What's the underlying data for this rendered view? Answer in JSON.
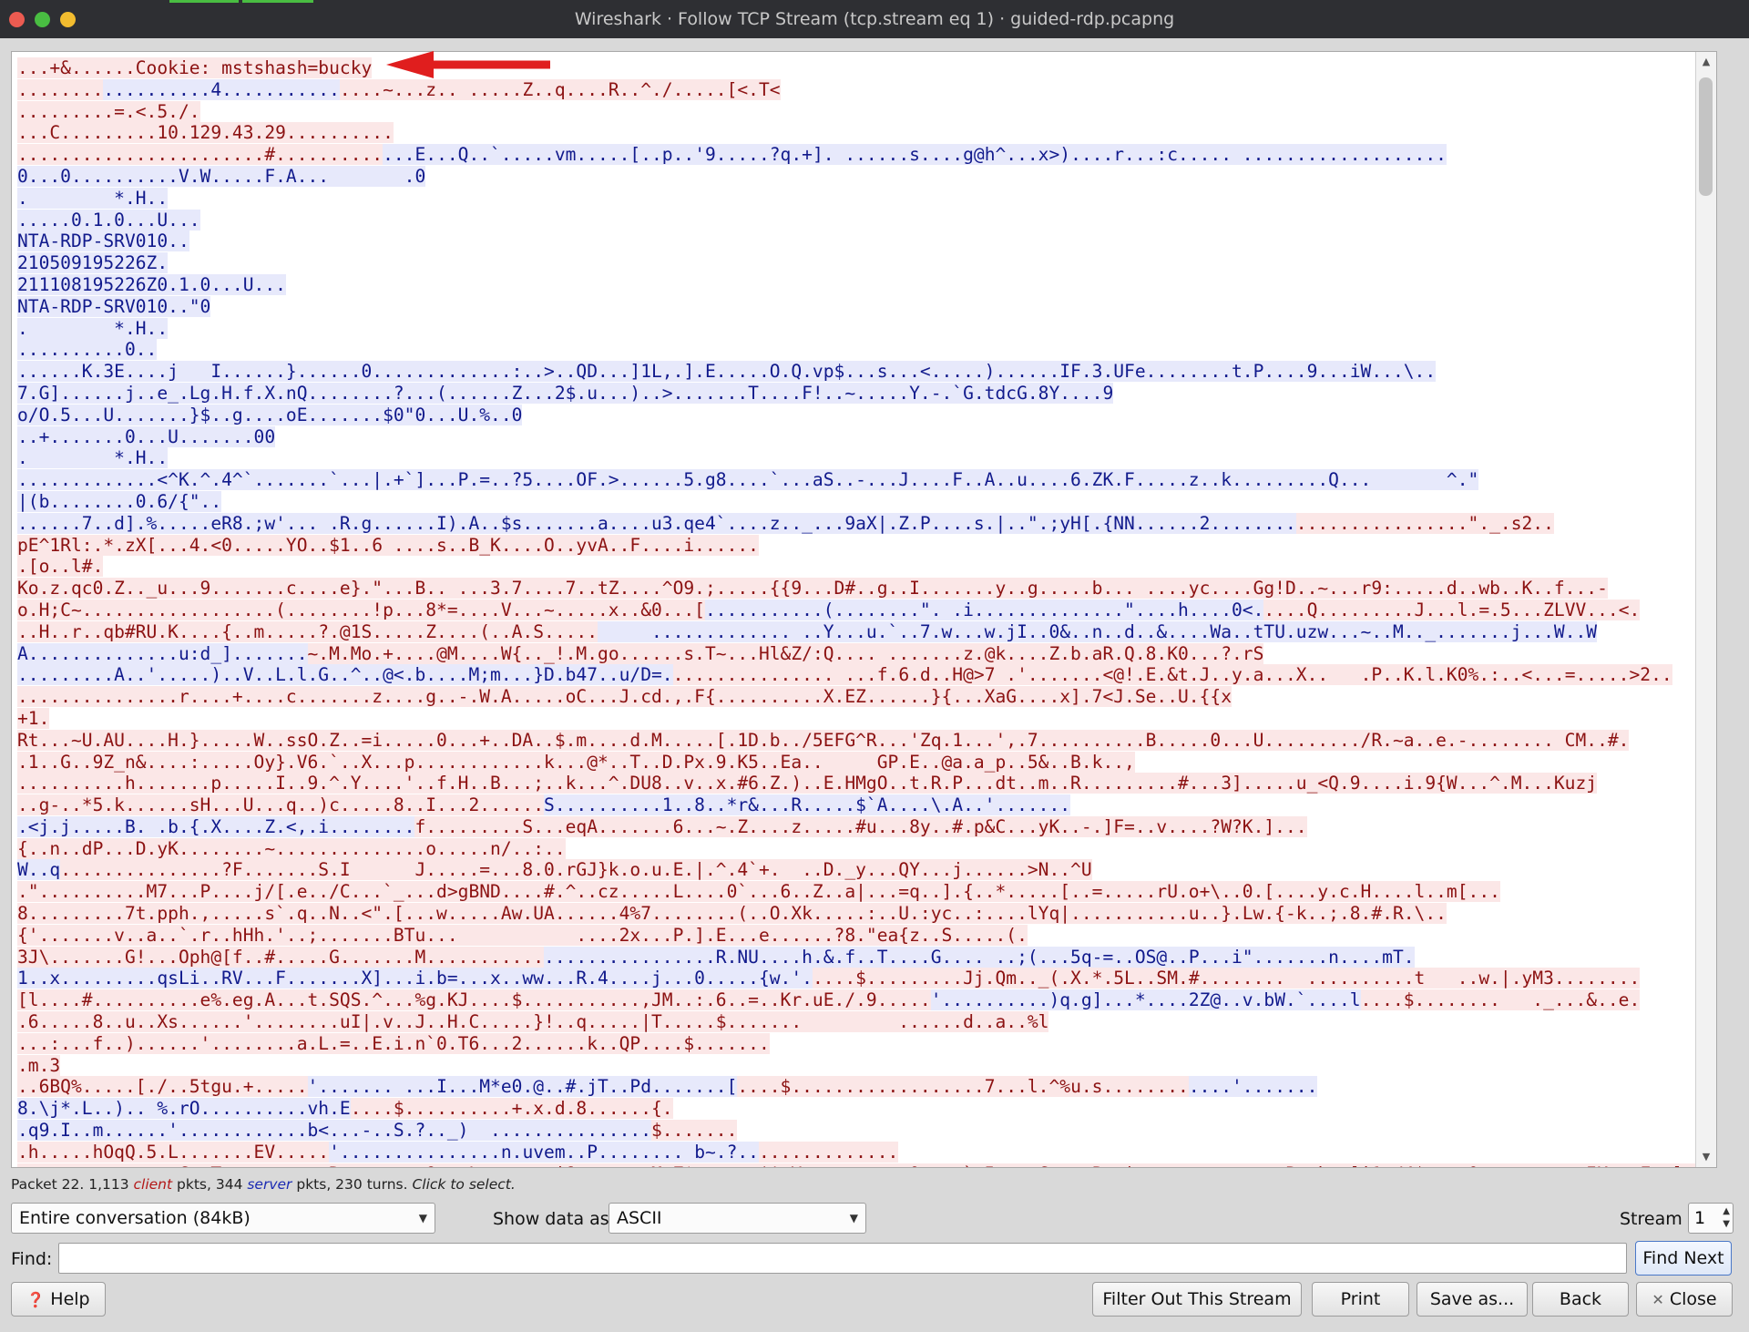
{
  "window": {
    "title": "Wireshark · Follow TCP Stream (tcp.stream eq 1) · guided-rdp.pcapng"
  },
  "stream_lines": [
    [
      {
        "t": "c",
        "x": "...+&......Cookie: mstshash=bucky"
      }
    ],
    [
      {
        "t": "c",
        "x": "........"
      },
      {
        "t": "s",
        "x": "..........4..........."
      },
      {
        "t": "c",
        "x": "....~...z.. .....Z..q....R..^./.....[<.T<"
      }
    ],
    [
      {
        "t": "c",
        "x": ".........=.<.5./."
      }
    ],
    [
      {
        "t": "c",
        "x": "...C.........10.129.43.29.........."
      }
    ],
    [
      {
        "t": "c",
        "x": ".......................#.........."
      },
      {
        "t": "s",
        "x": "...E...Q..`.....vm.....[..p..'9.....?q.+]. ......s....g@h^...x>)....r...:c..... ..................."
      }
    ],
    [
      {
        "t": "s",
        "x": "0...0..........V.W.....F.A...       .0"
      }
    ],
    [
      {
        "t": "s",
        "x": ".        *.H.."
      }
    ],
    [
      {
        "t": "s",
        "x": ".....0.1.0...U..."
      }
    ],
    [
      {
        "t": "s",
        "x": "NTA-RDP-SRV010.."
      }
    ],
    [
      {
        "t": "s",
        "x": "210509195226Z."
      }
    ],
    [
      {
        "t": "s",
        "x": "211108195226Z0.1.0...U..."
      }
    ],
    [
      {
        "t": "s",
        "x": "NTA-RDP-SRV010..\"0"
      }
    ],
    [
      {
        "t": "s",
        "x": ".        *.H.."
      }
    ],
    [
      {
        "t": "s",
        "x": "..........0.."
      }
    ],
    [
      {
        "t": "s",
        "x": "......K.3E....j   I......}......0.............:..>..QD...]1L,.].E.....O.Q.vp$...s...<.....)......IF.3.UFe........t.P....9...iW...\\.."
      }
    ],
    [
      {
        "t": "s",
        "x": "7.G]......j..e_.Lg.H.f.X.nQ........?...(......Z...2$.u...)..>.......T....F!..~.....Y.-.`G.tdcG.8Y....9"
      }
    ],
    [
      {
        "t": "s",
        "x": "o/O.5...U.......}$..g....oE.......$0\"0...U.%..0"
      }
    ],
    [
      {
        "t": "s",
        "x": "..+.......0...U.......00"
      }
    ],
    [
      {
        "t": "s",
        "x": ".        *.H.."
      }
    ],
    [
      {
        "t": "s",
        "x": ".............<^K.^.4^`.......`...|.+`]...P.=..?5....OF.>......5.g8....`...aS..-...J....F..A..u....6.ZK.F.....z..k.........Q...       ^.\""
      }
    ],
    [
      {
        "t": "s",
        "x": "|(b........0.6/{\".."
      }
    ],
    [
      {
        "t": "s",
        "x": "......7..d].%.....eR8.;w'... .R.g......I).A..$s.......a....u3.qe4`....z.._...9aX|.Z.P....s.|..\".;yH[.{NN......2........"
      },
      {
        "t": "c",
        "x": "................\"._.s2.."
      }
    ],
    [
      {
        "t": "c",
        "x": "pE^1Rl:.*.zX[...4.<0.....YO..$1..6 ....s..B_K....O..yvA..F....i......"
      }
    ],
    [
      {
        "t": "c",
        "x": ".[o..l#."
      }
    ],
    [
      {
        "t": "c",
        "x": "Ko.z.qc0.Z.._u...9.......c....e}.\"...B.. ...3.7....7..tZ....^O9.;.....{{9...D#..g..I.......y..g.....b... ....yc....Gg!D..~...r9:.....d..wb..K..f...-"
      }
    ],
    [
      {
        "t": "c",
        "x": "o.H;C~..................(........!p...8*=....V...~.....x..&0...["
      },
      {
        "t": "s",
        "x": "...........(........\". .i..............\"....h....0<."
      },
      {
        "t": "c",
        "x": "....Q.........J...l.=.5...ZLVV...<."
      }
    ],
    [
      {
        "t": "c",
        "x": "..H..r..qb#RU.K....{..m.....?.@1S.....Z....(..A.S....."
      },
      {
        "t": "s",
        "x": "     ............. ..Y...u.`..7.w...w.jI..0&..n..d..&....Wa..tTU.uzw...~..M.._.......j...W..W"
      }
    ],
    [
      {
        "t": "s",
        "x": "A..............u:d_]......."
      },
      {
        "t": "c",
        "x": "~.M.Mo.+....@M....W{.._!.M.go......s.T~...Hl&Z/:Q.... .......z.@k....Z.b.aR.Q.8.K0...?.rS"
      }
    ],
    [
      {
        "t": "s",
        "x": ".........A..'.....)..V..L.l.G..^..@<.b....M;m...}D.b47..u/D=."
      },
      {
        "t": "c",
        "x": "............... ...f.6.d..H@>7 .'.......<@!.E.&t.J..y.a...X..   .P..K.l.K0%.:..<...=.....>2.."
      }
    ],
    [
      {
        "t": "c",
        "x": "...............r....+....c.......z....g..-.W.A.....oC...J.cd.,.F{..........X.EZ......}{...XaG....x].7<J.Se..U.{{x"
      }
    ],
    [
      {
        "t": "c",
        "x": "+1."
      }
    ],
    [
      {
        "t": "c",
        "x": "Rt...~U.AU....H.}.....W..ssO.Z..=i.....0...+..DA..$.m....d.M.....[.1D.b../5EFG^R...'Zq.1...',.7..........B.....0...U........./R.~a..e.-........ CM..#."
      }
    ],
    [
      {
        "t": "c",
        "x": ".1..G..9Z_n&....:.....Oy}.V6.`..X...p............k...@*..T..D.Px.9.K5..Ea..     GP.E..@a.a_p..5&..B.k..,"
      }
    ],
    [
      {
        "t": "c",
        "x": "..........h.......p.....I..9.^.Y....'..f.H..B...;..k...^.DU8..v..x.#6.Z.)..E.HMgO..t.R.P...dt..m..R.........#...3].....u_<Q.9....i.9{W...^.M...Kuzj"
      }
    ],
    [
      {
        "t": "c",
        "x": "..g-..*5.k......sH...U...q..)c.....8..I...2......"
      },
      {
        "t": "s",
        "x": "S..........1..8..*r&...R.....$`A....\\.A..'......."
      }
    ],
    [
      {
        "t": "s",
        "x": ".<j.j.....B. .b.{.X....Z.<,.i........"
      },
      {
        "t": "c",
        "x": "f.........S...eqA.......6...~.Z....z.....#u...8y..#.p&C...yK..-.]F=..v....?W?K.]..."
      }
    ],
    [
      {
        "t": "c",
        "x": "{..n..dP...D.yK........~..............o.....n/..:.."
      }
    ],
    [
      {
        "t": "s",
        "x": "W..q"
      },
      {
        "t": "c",
        "x": "...............?F.......S.I      J.....=...8.0.rGJ}k.o.u.E.|.^.4`+.  ..D._y...QY...j......>N..^U"
      }
    ],
    [
      {
        "t": "c",
        "x": ".\"..........M7...P....j/[.e../C...`_...d>gBND....#.^..cz.....L....0`...6..Z..a|...=q..].{..*.....[..=.....rU.o+\\..0.[....y.c.H....l..m[..."
      }
    ],
    [
      {
        "t": "c",
        "x": "8.........7t.pph.,.....s`.q..N..<\".[...w.....Aw.UA......4%7........(..O.Xk.....:..U.:yc..:....lYq|...........u..}.Lw.{-k..;.8.#.R.\\.."
      }
    ],
    [
      {
        "t": "c",
        "x": "{'.......v..a..`.r..hHh.'..;.......BTu...           ....2x...P.].E...e......?8.\"ea{z..S.....(."
      }
    ],
    [
      {
        "t": "c",
        "x": "3J\\.......G!...Oph@[f..#.....G.......M..........."
      },
      {
        "t": "s",
        "x": "................R.NU....h.&.f..T....G.... ..;(...5q-=..OS@..P...i\".......n....mT."
      }
    ],
    [
      {
        "t": "s",
        "x": "1..x.........qsLi..RV...F.......X]...i.b=...x..ww...R.4....j...0.....{w.'."
      },
      {
        "t": "c",
        "x": "....$.........Jj.Qm.._(.X.*.5L..SM.#........  ..........t   ..w.|.yM3........"
      }
    ],
    [
      {
        "t": "c",
        "x": "[l....#..........e%.eg.A...t.SQS.^...%g.KJ....$...........,JM..:.6..=..Kr.uE./.9....."
      },
      {
        "t": "s",
        "x": "'..........)q.g]...*....2Z@..v.bW.`....l"
      },
      {
        "t": "c",
        "x": "....$........   ._...&..e."
      }
    ],
    [
      {
        "t": "c",
        "x": ".6.....8..u..Xs......'........uI|.v..J..H.C.....}!..q.....|T.....$.......         ......d..a..%l"
      }
    ],
    [
      {
        "t": "c",
        "x": "...:...f..)......'........a.L.=..E.i.n`0.T6...2......k..QP....$......."
      }
    ],
    [
      {
        "t": "c",
        "x": ".m.3"
      }
    ],
    [
      {
        "t": "c",
        "x": "..6BQ%.....[./..5tgu.+....."
      },
      {
        "t": "s",
        "x": "'....... ...I...M*e0.@..#.jT..Pd.......["
      },
      {
        "t": "c",
        "x": "....$..................7...l.^%u.s........"
      },
      {
        "t": "s",
        "x": "....'......."
      }
    ],
    [
      {
        "t": "s",
        "x": "8.\\j*.L..).. %.rO..........vh.E"
      },
      {
        "t": "c",
        "x": "....$..........+.x.d.8......{."
      }
    ],
    [
      {
        "t": "s",
        "x": ".q9.I..m......'............b<...-..S.?.._)  ..............."
      },
      {
        "t": "c",
        "x": "$......."
      }
    ],
    [
      {
        "t": "c",
        "x": ".h.....hOqQ.5.L.......EV....."
      },
      {
        "t": "s",
        "x": "'...............n.uvem..P........ b~.?.."
      },
      {
        "t": "c",
        "x": "............."
      }
    ],
    [
      {
        "t": "c",
        "x": "......g..r..v..C.zT..........R....r>.vO...L.......i&.......M.Z*......$'.V.....u....0....`.5.w..C....P@.|..............P..k@.]i1./4$....0z.o....~..IK...Fw.]........./"
      }
    ]
  ],
  "status": {
    "prefix": "Packet 22. 1,113 ",
    "client": "client",
    "middle": " pkts, 344 ",
    "server": "server",
    "suffix": " pkts, 230 turns.",
    "hint": "Click to select."
  },
  "conversation_select": {
    "value": "Entire conversation (84kB)"
  },
  "show_data_as": {
    "label": "Show data as",
    "value": "ASCII"
  },
  "stream": {
    "label": "Stream",
    "value": "1"
  },
  "find": {
    "label": "Find:",
    "value": "",
    "find_next_label": "Find Next"
  },
  "buttons": {
    "help": "Help",
    "filter_out": "Filter Out This Stream",
    "print": "Print",
    "save_as": "Save as...",
    "back": "Back",
    "close": "Close"
  },
  "colors": {
    "client_text": "#8c1212",
    "client_bg": "#fbe7e7",
    "server_text": "#111a8c",
    "server_bg": "#e7e9fb",
    "annotation_arrow": "#e01e1e"
  },
  "icons": [
    "help-icon",
    "close-icon",
    "annotation-arrow-icon"
  ]
}
